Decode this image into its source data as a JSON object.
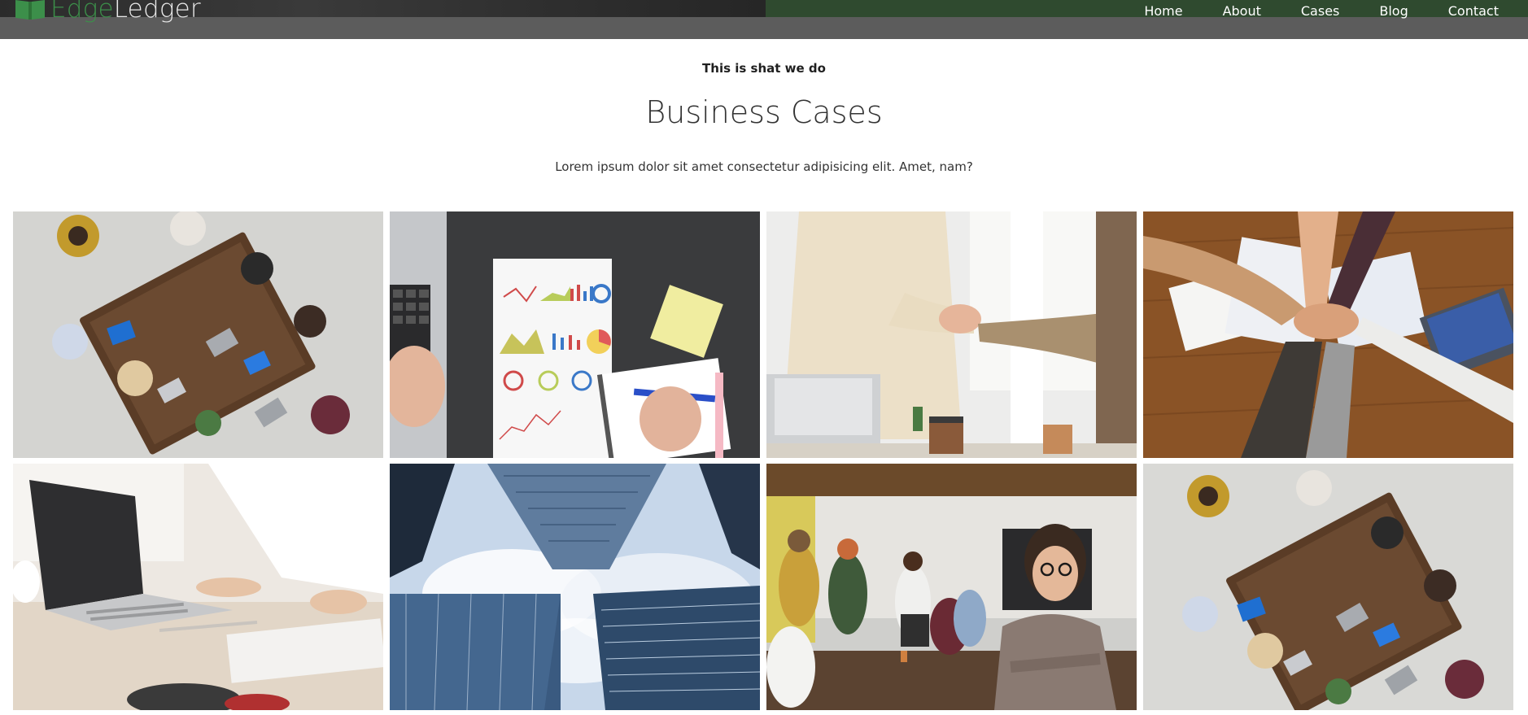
{
  "brand": {
    "name_part1": "Edge",
    "name_part2": "Ledger",
    "icon": "open-book-icon"
  },
  "nav": {
    "items": [
      {
        "label": "Home"
      },
      {
        "label": "About"
      },
      {
        "label": "Cases"
      },
      {
        "label": "Blog"
      },
      {
        "label": "Contact"
      }
    ]
  },
  "section": {
    "kicker": "This is shat we do",
    "title": "Business Cases",
    "subtitle": "Lorem ipsum dolor sit amet consectetur adipisicing elit. Amet, nam?"
  },
  "gallery": {
    "images": [
      {
        "name": "team-meeting-overhead-photo"
      },
      {
        "name": "charts-notebook-laptop-photo"
      },
      {
        "name": "handshake-photo"
      },
      {
        "name": "hands-stacked-teamwork-photo"
      },
      {
        "name": "laptop-typing-photo"
      },
      {
        "name": "skyscrapers-looking-up-photo"
      },
      {
        "name": "office-team-woman-portrait-photo"
      },
      {
        "name": "team-meeting-overhead-photo-2"
      }
    ]
  },
  "colors": {
    "brand_green": "#3c8f4a",
    "nav_green_band": "#2f4a2f",
    "topbar_gray": "#5c5c5c",
    "nav_text": "#ffffff"
  }
}
